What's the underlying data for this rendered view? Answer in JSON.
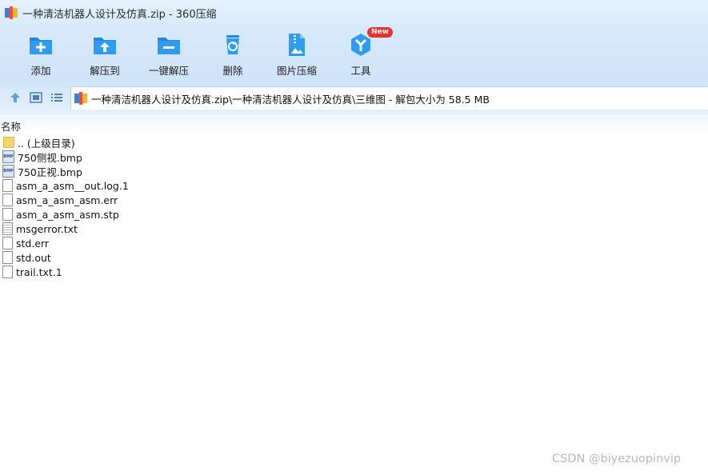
{
  "window": {
    "title": "一种清洁机器人设计及仿真.zip - 360压缩"
  },
  "toolbar": {
    "items": [
      {
        "label": "添加",
        "icon": "add-icon"
      },
      {
        "label": "解压到",
        "icon": "extract-to-icon"
      },
      {
        "label": "一键解压",
        "icon": "one-click-extract-icon"
      },
      {
        "label": "删除",
        "icon": "delete-icon"
      },
      {
        "label": "图片压缩",
        "icon": "image-compress-icon"
      },
      {
        "label": "工具",
        "icon": "tools-icon",
        "badge": "New"
      }
    ]
  },
  "nav": {
    "path": "一种清洁机器人设计及仿真.zip\\一种清洁机器人设计及仿真\\三维图 - 解包大小为 58.5 MB"
  },
  "columns": {
    "name": "名称"
  },
  "files": [
    {
      "name": ".. (上级目录)",
      "type": "folder"
    },
    {
      "name": "750侧视.bmp",
      "type": "bmp"
    },
    {
      "name": "750正视.bmp",
      "type": "bmp"
    },
    {
      "name": "asm_a_asm__out.log.1",
      "type": "file"
    },
    {
      "name": "asm_a_asm_asm.err",
      "type": "file"
    },
    {
      "name": "asm_a_asm_asm.stp",
      "type": "file"
    },
    {
      "name": "msgerror.txt",
      "type": "txt"
    },
    {
      "name": "std.err",
      "type": "file"
    },
    {
      "name": "std.out",
      "type": "file"
    },
    {
      "name": "trail.txt.1",
      "type": "file"
    }
  ],
  "watermark": "CSDN @biyezuopinvip",
  "colors": {
    "accent": "#1e88e5",
    "toolbar_bg": "#d8eafb",
    "badge": "#e8322c"
  }
}
